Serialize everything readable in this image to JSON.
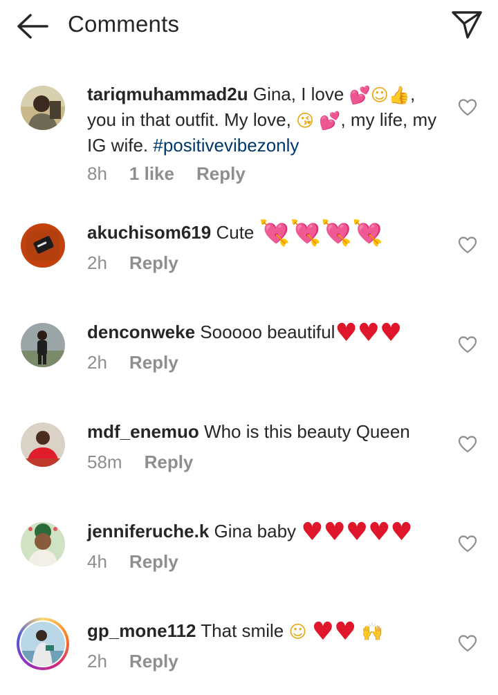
{
  "header": {
    "title": "Comments",
    "back_icon": "arrow-left-icon",
    "send_icon": "paper-plane-icon"
  },
  "colors": {
    "text": "#262626",
    "muted": "#8e8e8e",
    "hashtag": "#00376b",
    "heart": "#e0162b"
  },
  "reply_label": "Reply",
  "comments": [
    {
      "username": "tariqmuhammad2u",
      "text_1": "Gina, I love",
      "text_2": ",",
      "text_3": "you in that outfit. My love,",
      "text_4": ", my life,",
      "text_5": "my IG wife.",
      "hashtag": "#positivevibezonly",
      "time": "8h",
      "likes": "1 like"
    },
    {
      "username": "akuchisom619",
      "text": "Cute",
      "time": "2h"
    },
    {
      "username": "denconweke",
      "text": "Sooooo beautiful",
      "time": "2h"
    },
    {
      "username": "mdf_enemuo",
      "text": "Who is this beauty Queen",
      "time": "58m"
    },
    {
      "username": "jenniferuche.k",
      "text": "Gina baby",
      "time": "4h"
    },
    {
      "username": "gp_mone112",
      "text": "That smile",
      "time": "2h"
    }
  ]
}
